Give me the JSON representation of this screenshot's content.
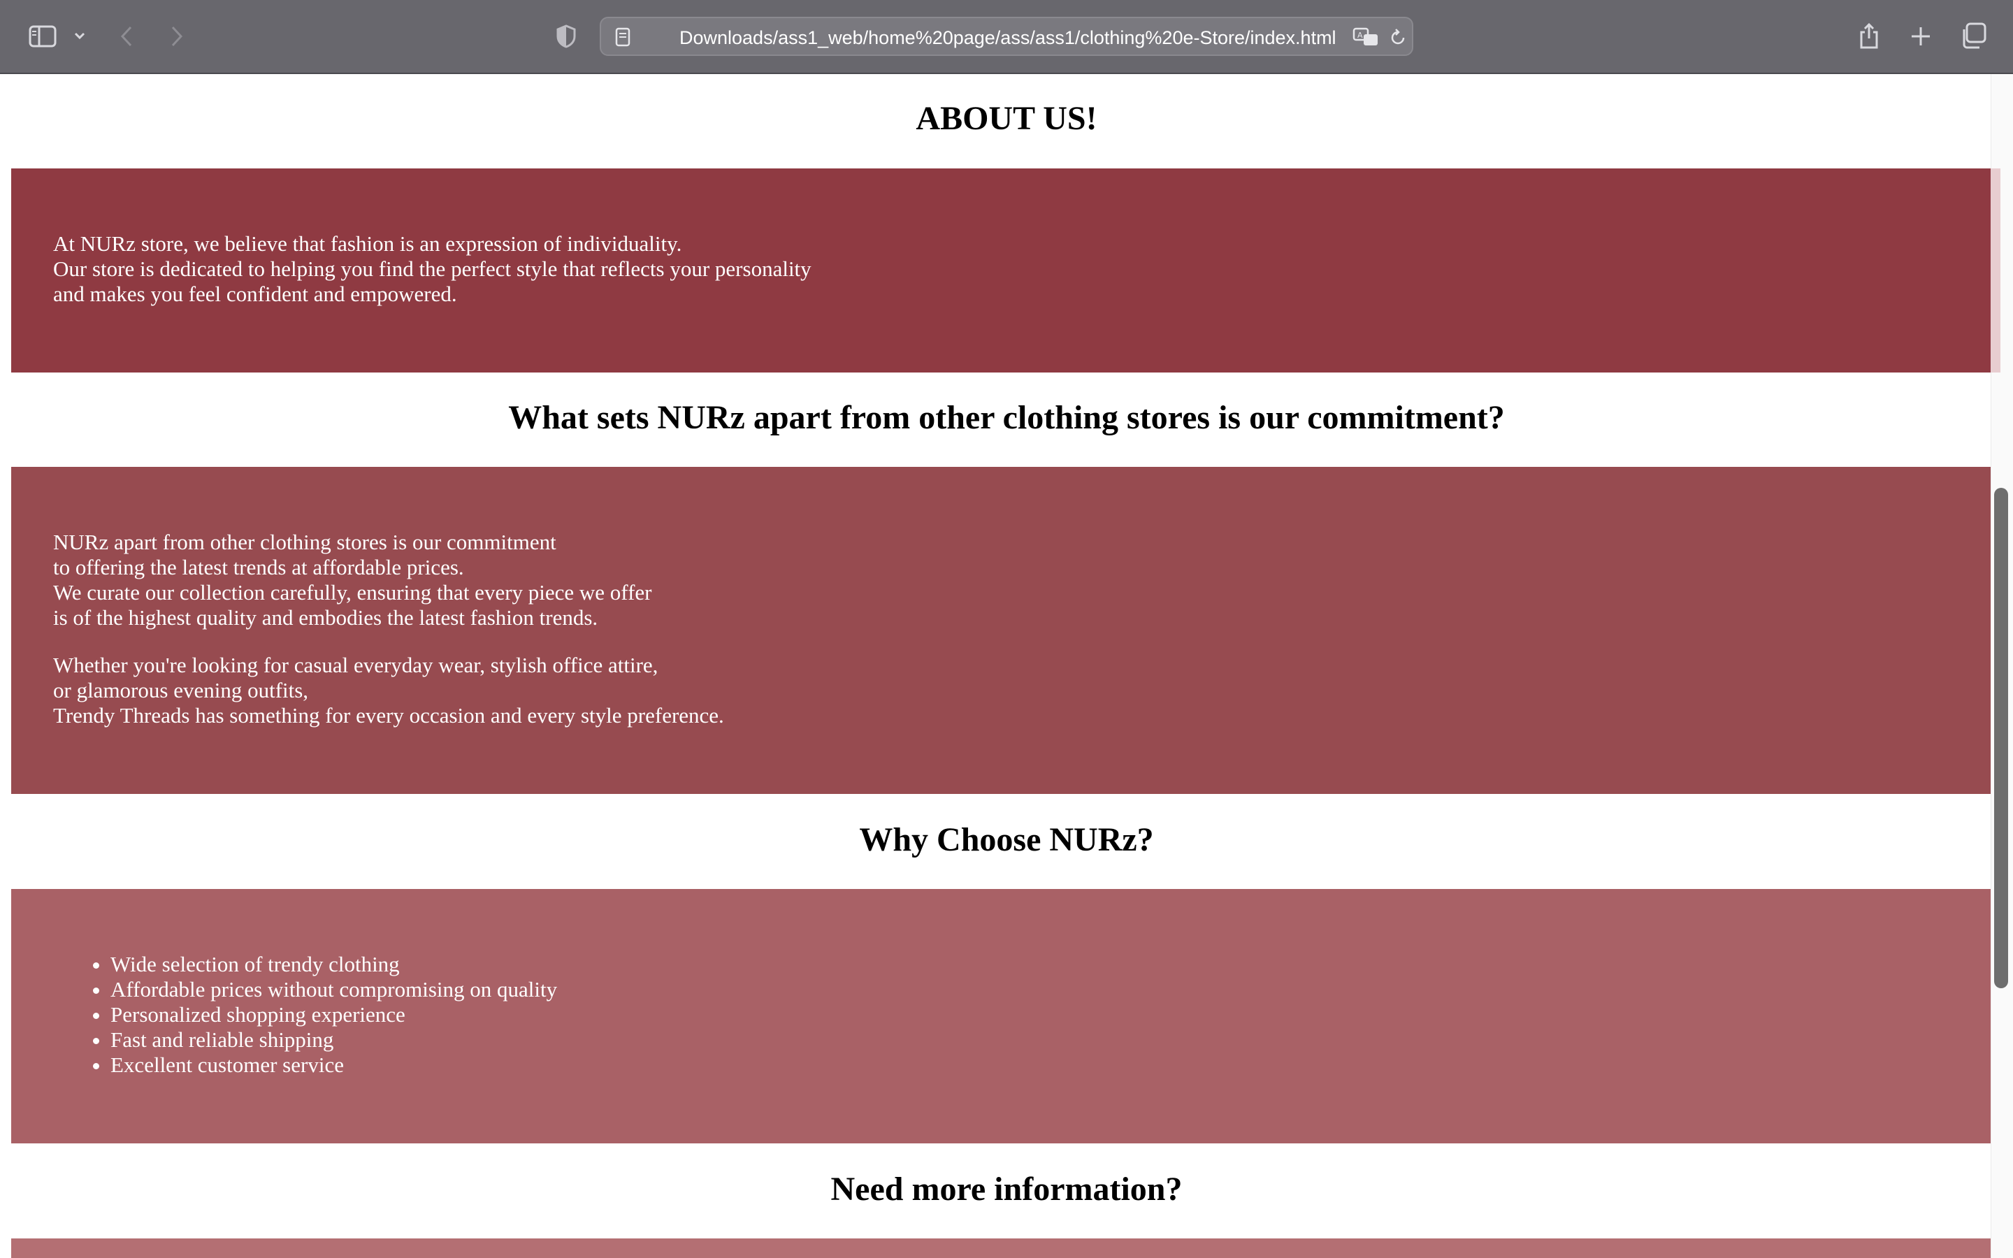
{
  "browser": {
    "url": "Downloads/ass1_web/home%20page/ass/ass1/clothing%20e-Store/index.html",
    "icons": [
      "sidebar-icon",
      "chevron-down-icon",
      "back-icon",
      "forward-icon",
      "shield-icon",
      "page-icon",
      "translate-icon",
      "reload-icon",
      "share-icon",
      "plus-icon",
      "tabs-icon"
    ]
  },
  "sections": {
    "about": {
      "heading": "ABOUT US!",
      "lines": [
        "At NURz store, we believe that fashion is an expression of individuality.",
        "Our store is dedicated to helping you find the perfect style that reflects your personality",
        "and makes you feel confident and empowered."
      ],
      "color": "#8f3a42"
    },
    "commitment": {
      "heading": "What sets NURz apart from other clothing stores is our commitment?",
      "paragraph1": [
        "NURz apart from other clothing stores is our commitment",
        "to offering the latest trends at affordable prices.",
        "We curate our collection carefully, ensuring that every piece we offer",
        "is of the highest quality and embodies the latest fashion trends."
      ],
      "paragraph2": [
        "Whether you're looking for casual everyday wear, stylish office attire,",
        "or glamorous evening outfits,",
        "Trendy Threads has something for every occasion and every style preference."
      ],
      "color": "#974b50"
    },
    "why": {
      "heading": "Why Choose NURz?",
      "items": [
        "Wide selection of trendy clothing",
        "Affordable prices without compromising on quality",
        "Personalized shopping experience",
        "Fast and reliable shipping",
        "Excellent customer service"
      ],
      "color": "#a96166"
    },
    "info": {
      "heading": "Need more information?",
      "color": "#b46f73"
    }
  }
}
